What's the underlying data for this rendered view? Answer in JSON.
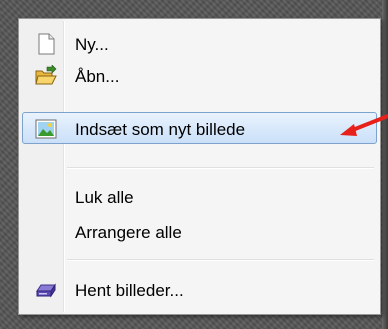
{
  "menu": {
    "items": [
      {
        "label": "Ny...",
        "icon": "new-document-icon"
      },
      {
        "label": "Åbn...",
        "icon": "open-folder-icon"
      },
      {
        "label": "Indsæt som nyt billede",
        "icon": "paste-image-icon",
        "highlighted": true
      },
      {
        "label": "Luk alle",
        "icon": ""
      },
      {
        "label": "Arrangere alle",
        "icon": ""
      },
      {
        "label": "Hent billeder...",
        "icon": "scanner-icon"
      }
    ]
  },
  "annotation": {
    "type": "red-arrow",
    "color": "#e8201a",
    "points_to": "Indsæt som nyt billede"
  },
  "colors": {
    "highlight_border": "#7da2ce",
    "menu_bg": "#f5f5f5",
    "backdrop": "#565656"
  }
}
